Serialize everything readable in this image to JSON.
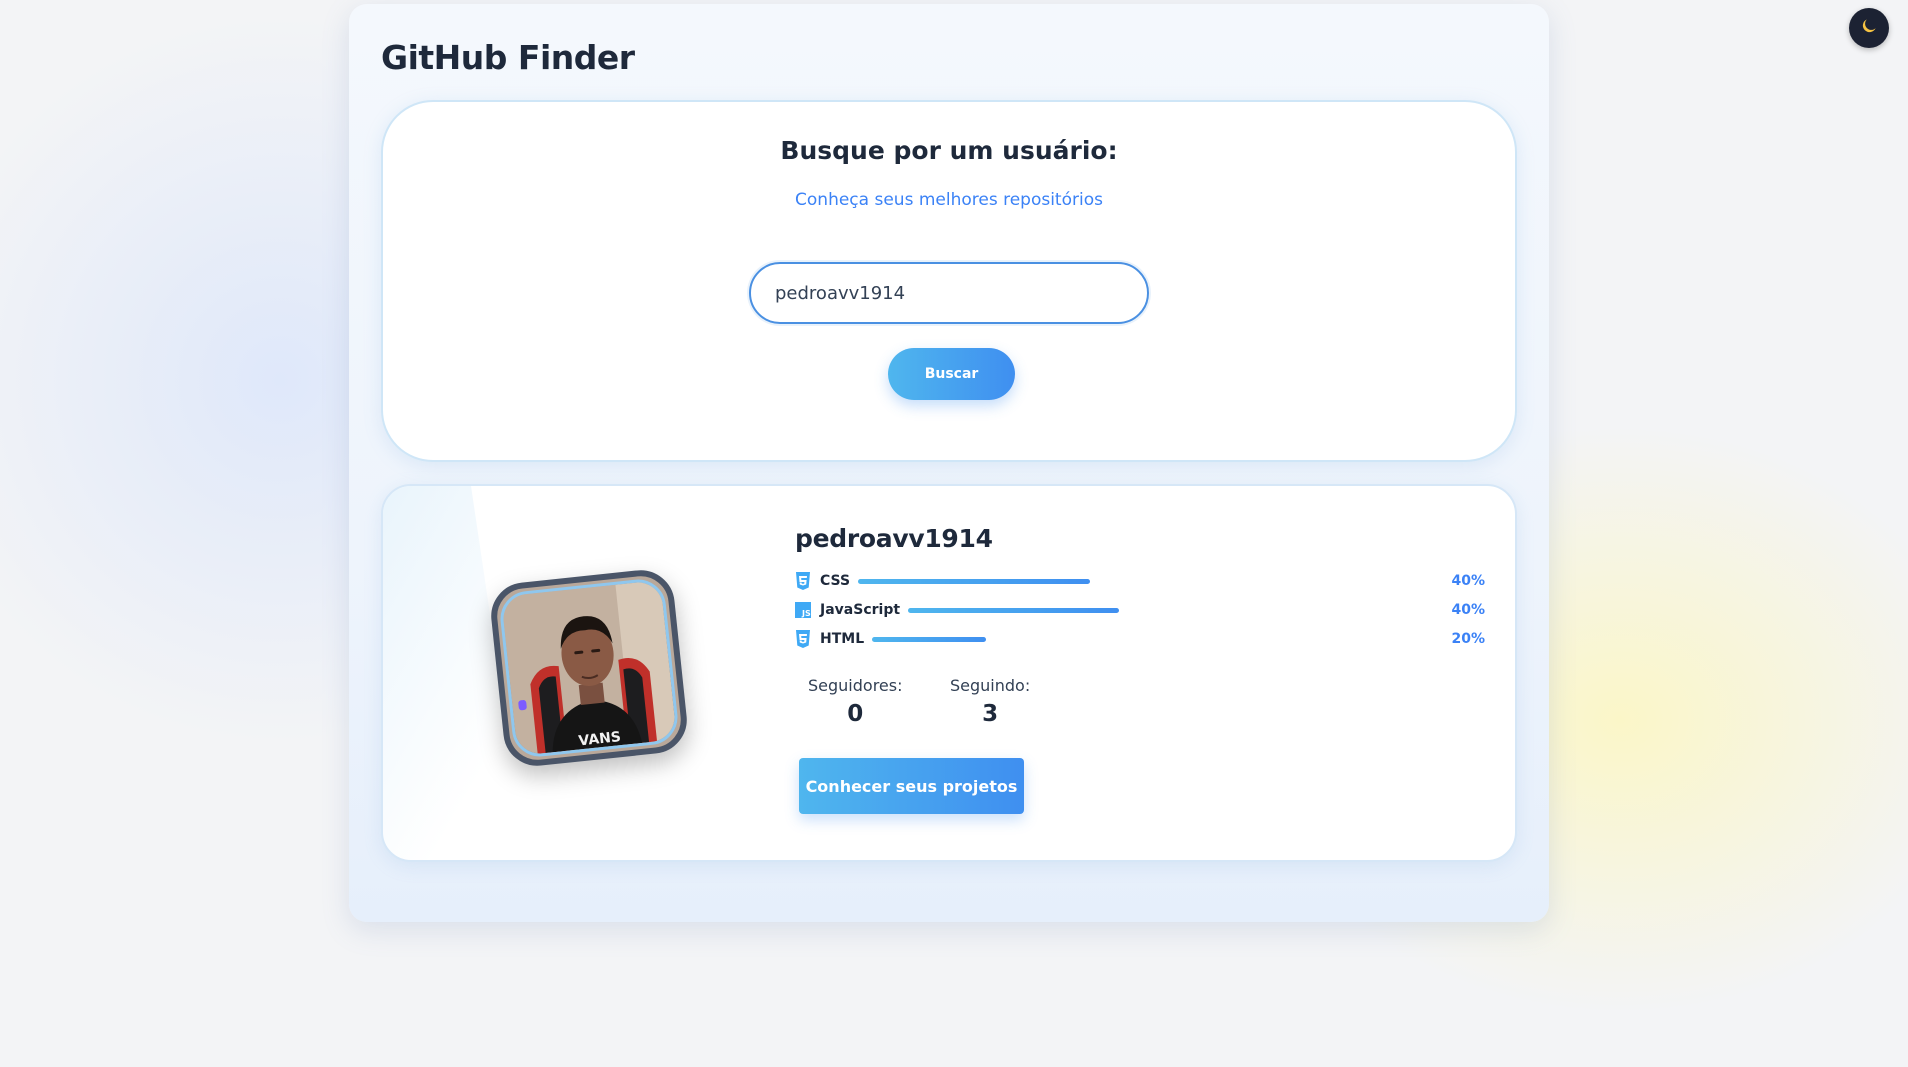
{
  "app": {
    "title": "GitHub Finder"
  },
  "theme_toggle": {
    "icon": "moon-icon",
    "icon_color": "#f6c343"
  },
  "search": {
    "heading": "Busque por um usuário:",
    "subheading": "Conheça seus melhores repositórios",
    "input_value": "pedroavv1914",
    "button_label": "Buscar"
  },
  "profile": {
    "username": "pedroavv1914",
    "languages": [
      {
        "name": "CSS",
        "icon": "css3-icon",
        "percent_label": "40%"
      },
      {
        "name": "JavaScript",
        "icon": "javascript-icon",
        "percent_label": "40%"
      },
      {
        "name": "HTML",
        "icon": "html5-icon",
        "percent_label": "20%"
      }
    ],
    "followers_label": "Seguidores:",
    "followers_value": "0",
    "following_label": "Seguindo:",
    "following_value": "3",
    "projects_button_label": "Conhecer seus projetos"
  },
  "colors": {
    "accent": "#3b82f6",
    "accent_light": "#4fb6ee",
    "text": "#1e293b"
  }
}
